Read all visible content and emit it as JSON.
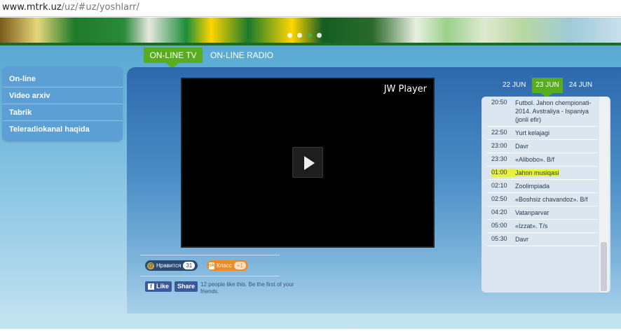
{
  "address_bar": {
    "host": "www.mtrk.uz",
    "path": "/uz/#uz/yoshlarr/"
  },
  "sidebar": {
    "items": [
      {
        "label": "On-line"
      },
      {
        "label": "Video arxiv"
      },
      {
        "label": "Tabrik"
      },
      {
        "label": "Teleradiokanal haqida"
      }
    ]
  },
  "tabs": {
    "tv": "ON-LINE TV",
    "radio": "ON-LINE RADIO"
  },
  "player": {
    "brand": "JW Player"
  },
  "dates": {
    "d1": "22 JUN",
    "d2": "23 JUN",
    "d3": "24 JUN",
    "active": "23 JUN"
  },
  "schedule": {
    "items": [
      {
        "time": "20:50",
        "name": "Futbol. Jahon chempionati-2014. Avstraliya - Ispaniya (jonli efir)"
      },
      {
        "time": "22:50",
        "name": "Yurt kelajagi"
      },
      {
        "time": "23:00",
        "name": "Davr"
      },
      {
        "time": "23:30",
        "name": "«Alibobo». B/f"
      },
      {
        "time": "01:00",
        "name": "Jahon musiqasi"
      },
      {
        "time": "02:10",
        "name": "Zoolimpiada"
      },
      {
        "time": "02:50",
        "name": "«Boshsiz chavandoz». B/f"
      },
      {
        "time": "04:20",
        "name": "Vatanparvar"
      },
      {
        "time": "05:00",
        "name": "«Izzat». T/s"
      },
      {
        "time": "05:30",
        "name": "Davr"
      }
    ],
    "highlighted_time": "01:00"
  },
  "social": {
    "vk_label": "Нравится",
    "vk_count": "31",
    "ok_label": "Класс",
    "ok_count": "+1",
    "fb_like": "Like",
    "fb_share": "Share",
    "fb_text": "12 people like this. Be the first of your friends."
  },
  "colors": {
    "accent_green": "#58ad1f",
    "panel_blue": "#2d68ad",
    "highlight": "#e9f13a"
  }
}
